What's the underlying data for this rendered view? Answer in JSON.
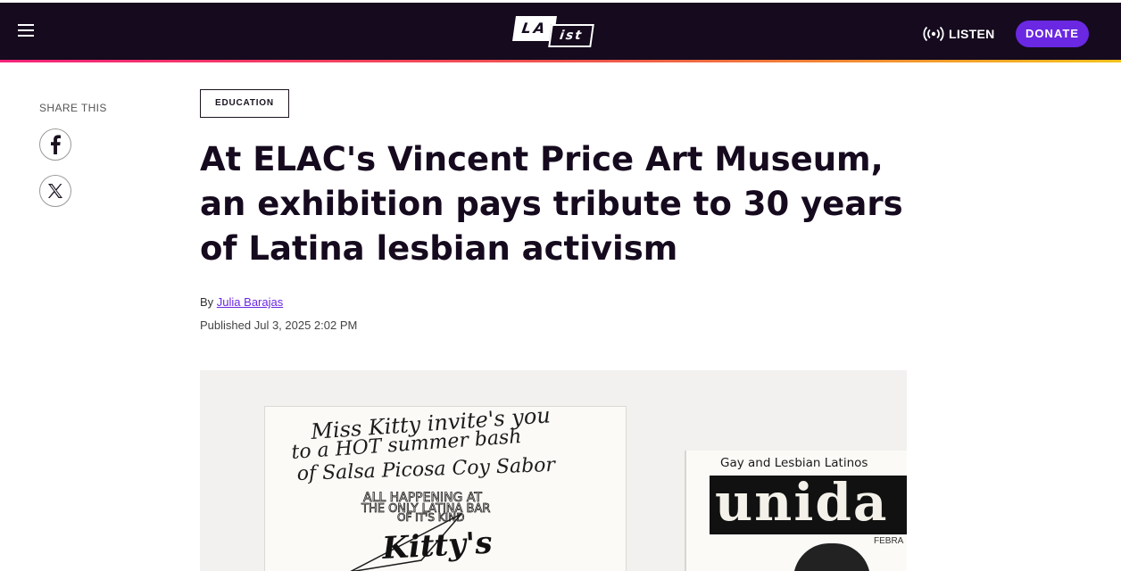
{
  "header": {
    "logo": {
      "part1": "LA",
      "part2": "ist"
    },
    "listen_label": "LISTEN",
    "donate_label": "DONATE",
    "accent": "#6a28e2",
    "background": "#150a1e"
  },
  "share": {
    "label": "SHARE THIS",
    "buttons": [
      {
        "icon": "facebook-icon"
      },
      {
        "icon": "x-icon"
      }
    ]
  },
  "article": {
    "category": "EDUCATION",
    "headline": "At ELAC's Vincent Price Art Museum, an exhibition pays tribute to 30 years of Latina lesbian activism",
    "byline_prefix": "By",
    "author": "Julia Barajas",
    "published": "Published Jul 3, 2025 2:02 PM"
  },
  "hero_image": {
    "flyer_lines": [
      "Miss Kitty invite's you",
      "to a HOT summer bash",
      "of Salsa Picosa Coy Sabor",
      "ALL HAPPENING AT",
      "THE ONLY LATINA BAR",
      "OF IT'S KIND",
      "Kitty's"
    ],
    "magazine_header": "Gay and Lesbian Latinos",
    "magazine_title": "unida",
    "magazine_date": "FEBRA"
  }
}
